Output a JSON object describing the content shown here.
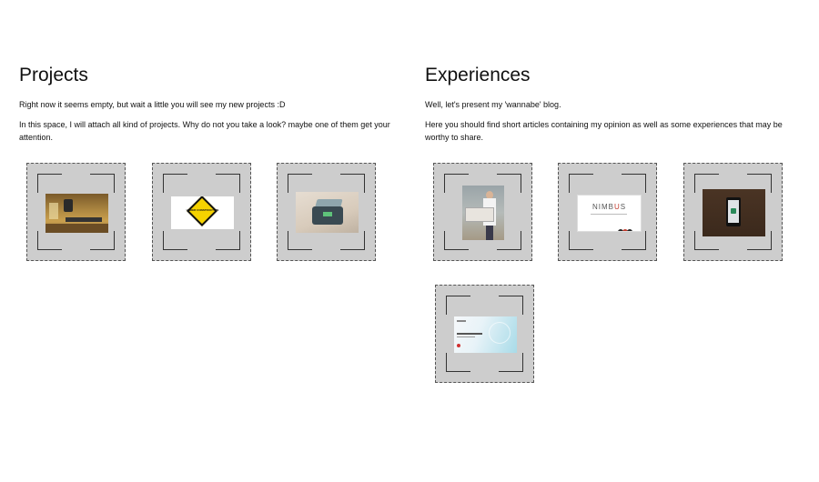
{
  "projects": {
    "title": "Projects",
    "paragraphs": [
      "Right now it seems empty, but wait a little you will see my new projects :D",
      "In this space, I will attach all kind of projects. Why do not you take a look? maybe one of them get your attention."
    ],
    "sign_text": "UNDER CONSTRUCTION"
  },
  "experiences": {
    "title": "Experiences",
    "paragraphs": [
      "Well, let's present my 'wannabe' blog.",
      "Here you should find short articles containing my opinion as well as some experiences that may be worthy to share."
    ],
    "nimbus_logo_a": "NIMB",
    "nimbus_logo_b": "U",
    "nimbus_logo_c": "S"
  }
}
